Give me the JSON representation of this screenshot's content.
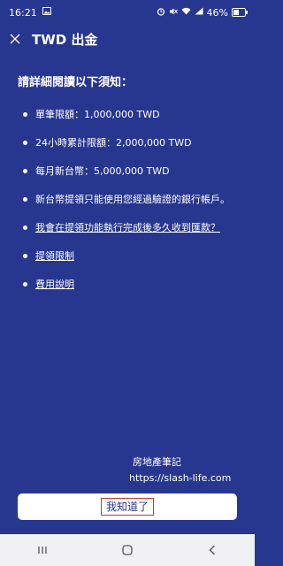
{
  "status_bar": {
    "time": "16:21",
    "battery_percent": "46%",
    "battery_level": 0.46
  },
  "app_bar": {
    "title": "TWD 出金"
  },
  "notice": {
    "heading": "請詳細閱讀以下須知：",
    "items": [
      {
        "text": "單筆限額：1,000,000 TWD"
      },
      {
        "text": "24小時累計限額：2,000,000 TWD"
      },
      {
        "text": "每月新台幣：5,000,000 TWD"
      },
      {
        "text": "新台幣提領只能使用您經過驗證的銀行帳戶。"
      }
    ],
    "links": [
      {
        "text": "我會在提領功能執行完成後多久收到匯款？"
      },
      {
        "text": "提領限制"
      },
      {
        "text": "費用說明"
      }
    ]
  },
  "watermark": {
    "title": "房地產筆記",
    "url": "https://slash-life.com"
  },
  "confirm_button": {
    "label": "我知道了"
  },
  "colors": {
    "background": "#27378f",
    "button_bg": "#ffffff",
    "highlight_border": "#c53a3a",
    "navbar_bg": "#f1f1f3"
  }
}
